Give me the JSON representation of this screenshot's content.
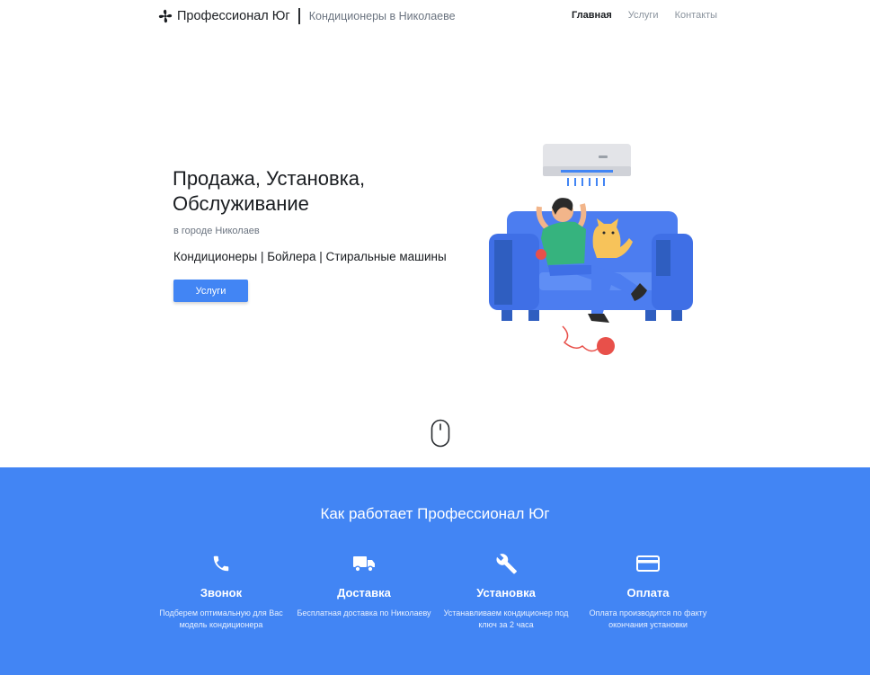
{
  "brand": {
    "name": "Профессионал Юг",
    "subtitle": "Кондиционеры в Николаеве"
  },
  "nav": [
    {
      "label": "Главная",
      "active": true
    },
    {
      "label": "Услуги",
      "active": false
    },
    {
      "label": "Контакты",
      "active": false
    }
  ],
  "hero": {
    "title": "Продажа, Установка, Обслуживание",
    "city": "в городе Николаев",
    "services": "Кондиционеры | Бойлера | Стиральные машины",
    "button_label": "Услуги"
  },
  "how": {
    "title": "Как работает Профессионал Юг",
    "steps": [
      {
        "icon": "phone-icon",
        "title": "Звонок",
        "desc": "Подберем оптимальную для Вас модель кондиционера"
      },
      {
        "icon": "truck-icon",
        "title": "Доставка",
        "desc": "Бесплатная доставка по Николаеву"
      },
      {
        "icon": "wrench-icon",
        "title": "Установка",
        "desc": "Устанавливаем кондиционер под ключ за 2 часа"
      },
      {
        "icon": "credit-card-icon",
        "title": "Оплата",
        "desc": "Оплата производится по факту окончания установки"
      }
    ]
  },
  "colors": {
    "accent": "#4285f4",
    "text": "#1a1d21",
    "muted": "#6b7480"
  }
}
